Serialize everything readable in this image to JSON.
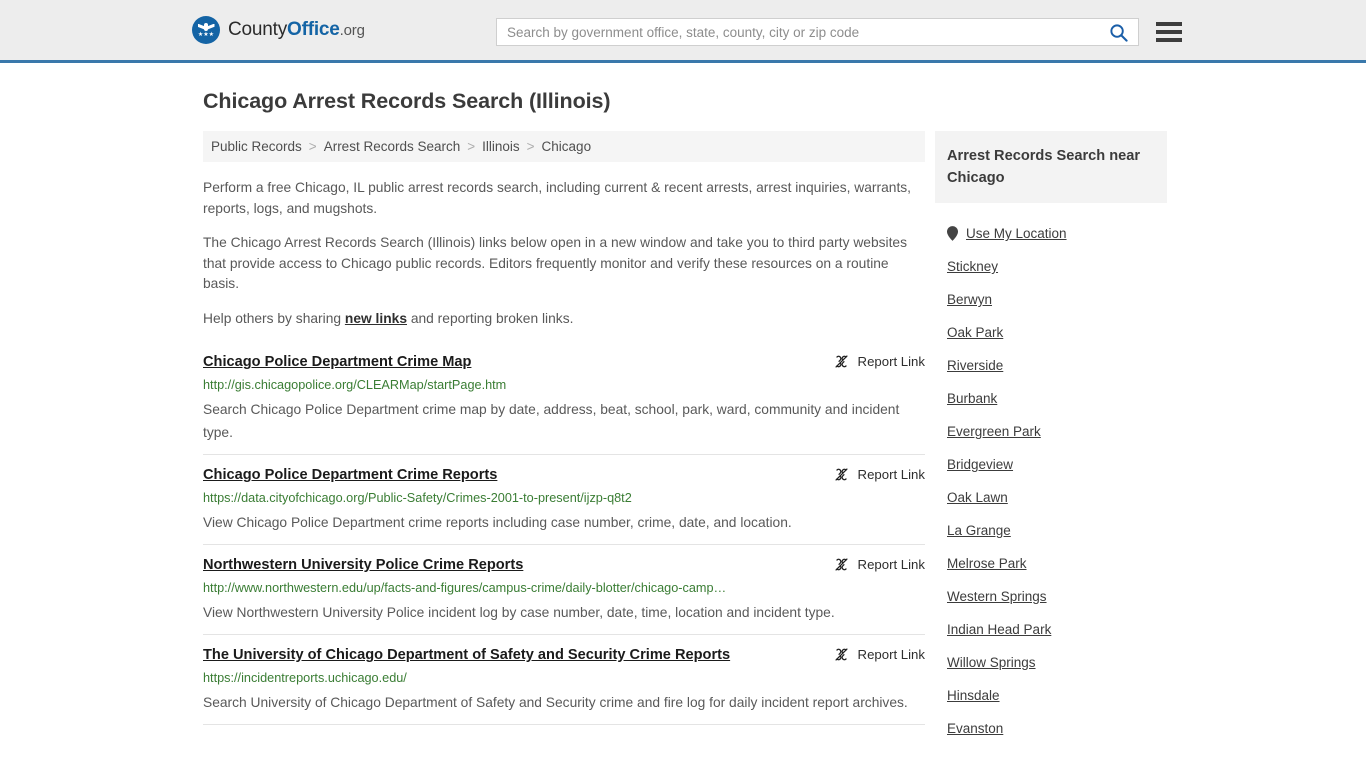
{
  "header": {
    "logo": {
      "part1": "County",
      "part2": "Office",
      "part3": ".org",
      "icon": "eagle-star-emblem",
      "stars": "★★★"
    },
    "search": {
      "placeholder": "Search by government office, state, county, city or zip code",
      "value": "",
      "icon": "search-icon"
    },
    "menu_icon": "hamburger-menu-icon",
    "accent_color": "#3a78ab",
    "background_color": "#ededed"
  },
  "page": {
    "title": "Chicago Arrest Records Search (Illinois)",
    "breadcrumb": [
      {
        "label": "Public Records"
      },
      {
        "label": "Arrest Records Search"
      },
      {
        "label": "Illinois"
      },
      {
        "label": "Chicago"
      }
    ],
    "breadcrumb_separator": ">",
    "intro": {
      "p1": "Perform a free Chicago, IL public arrest records search, including current & recent arrests, arrest inquiries, warrants, reports, logs, and mugshots.",
      "p2": "The Chicago Arrest Records Search (Illinois) links below open in a new window and take you to third party websites that provide access to Chicago public records. Editors frequently monitor and verify these resources on a routine basis.",
      "p3_before": "Help others by sharing ",
      "p3_link": "new links",
      "p3_after": " and reporting broken links."
    }
  },
  "results": {
    "report_label": "Report Link",
    "report_icon": "broken-link-icon",
    "items": [
      {
        "title": "Chicago Police Department Crime Map",
        "url": "http://gis.chicagopolice.org/CLEARMap/startPage.htm",
        "description": "Search Chicago Police Department crime map by date, address, beat, school, park, ward, community and incident type."
      },
      {
        "title": "Chicago Police Department Crime Reports",
        "url": "https://data.cityofchicago.org/Public-Safety/Crimes-2001-to-present/ijzp-q8t2",
        "description": "View Chicago Police Department crime reports including case number, crime, date, and location."
      },
      {
        "title": "Northwestern University Police Crime Reports",
        "url": "http://www.northwestern.edu/up/facts-and-figures/campus-crime/daily-blotter/chicago-camp…",
        "description": "View Northwestern University Police incident log by case number, date, time, location and incident type."
      },
      {
        "title": "The University of Chicago Department of Safety and Security Crime Reports",
        "url": "https://incidentreports.uchicago.edu/",
        "description": "Search University of Chicago Department of Safety and Security crime and fire log for daily incident report archives."
      }
    ]
  },
  "sidebar": {
    "heading": "Arrest Records Search near Chicago",
    "use_my_location": {
      "label": "Use My Location",
      "icon": "map-pin-icon"
    },
    "cities": [
      {
        "label": "Stickney"
      },
      {
        "label": "Berwyn"
      },
      {
        "label": "Oak Park"
      },
      {
        "label": "Riverside"
      },
      {
        "label": "Burbank"
      },
      {
        "label": "Evergreen Park"
      },
      {
        "label": "Bridgeview"
      },
      {
        "label": "Oak Lawn"
      },
      {
        "label": "La Grange"
      },
      {
        "label": "Melrose Park"
      },
      {
        "label": "Western Springs"
      },
      {
        "label": "Indian Head Park"
      },
      {
        "label": "Willow Springs"
      },
      {
        "label": "Hinsdale"
      },
      {
        "label": "Evanston"
      }
    ]
  },
  "colors": {
    "url_green": "#3a7d34",
    "link_blue": "#1464a5",
    "text_gray": "#595959"
  }
}
